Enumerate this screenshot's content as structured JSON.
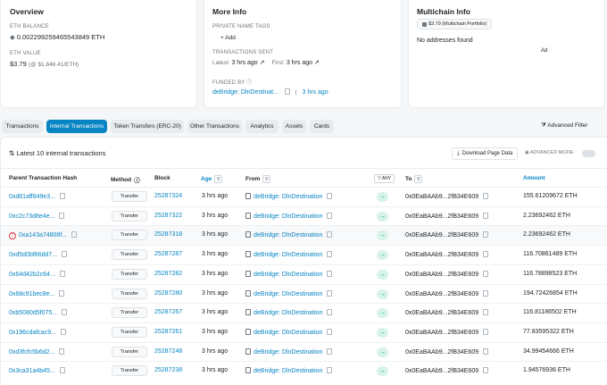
{
  "overview": {
    "title": "Overview",
    "eth_balance_label": "ETH BALANCE",
    "eth_balance": "0.002299259465543849 ETH",
    "eth_value_label": "ETH VALUE",
    "eth_value": "$3.79",
    "eth_value_rate": "(@ $1,646.41/ETH)"
  },
  "more_info": {
    "title": "More Info",
    "tags_label": "PRIVATE NAME TAGS",
    "add_label": "+ Add",
    "tx_sent_label": "TRANSACTIONS SENT",
    "latest_prefix": "Latest:",
    "latest_value": "3 hrs ago",
    "first_prefix": "First:",
    "first_value": "3 hrs ago",
    "funded_label": "FUNDED BY",
    "funded_by": "deBridge: DlnDestinat...",
    "funded_time": "3 hrs ago"
  },
  "multichain": {
    "title": "Multichain Info",
    "badge": "$3.79 (Multichain Portfolio)",
    "no_addresses": "No addresses found",
    "ad": "Ad"
  },
  "tabs": [
    {
      "label": "Transactions"
    },
    {
      "label": "Internal Transactions"
    },
    {
      "label": "Token Transfers (ERC-20)"
    },
    {
      "label": "Other Transactions"
    },
    {
      "label": "Analytics"
    },
    {
      "label": "Assets"
    },
    {
      "label": "Cards"
    }
  ],
  "advanced_filter": "Advanced Filter",
  "table": {
    "summary": "Latest 10 internal transactions",
    "download": "Download Page Data",
    "advanced_mode": "ADVANCED MODE:",
    "headers": {
      "hash": "Parent Transaction Hash",
      "method": "Method",
      "block": "Block",
      "age": "Age",
      "from": "From",
      "any": "ANY",
      "to": "To",
      "amount": "Amount"
    },
    "rows": [
      {
        "hash": "0xd81aff849e3...",
        "method": "Transfer",
        "block": "25287324",
        "age": "3 hrs ago",
        "from": "deBridge: DlnDestination",
        "to": "0x0EaBAAb9...2fB34E609",
        "amount": "155.61209672 ETH"
      },
      {
        "hash": "0xc2c73d8e4e...",
        "method": "Transfer",
        "block": "25287322",
        "age": "3 hrs ago",
        "from": "deBridge: DlnDestination",
        "to": "0x0EaBAAb9...2fB34E609",
        "amount": "2.23692462 ETH"
      },
      {
        "hash": "0xa143a74808f...",
        "method": "Transfer",
        "block": "25287318",
        "age": "3 hrs ago",
        "from": "deBridge: DlnDestination",
        "to": "0x0EaBAAb9...2fB34E609",
        "amount": "2.23692462 ETH"
      },
      {
        "hash": "0xd5d0bf86dd7...",
        "method": "Transfer",
        "block": "25287287",
        "age": "3 hrs ago",
        "from": "deBridge: DlnDestination",
        "to": "0x0EaBAAb9...2fB34E609",
        "amount": "116.70861489 ETH"
      },
      {
        "hash": "0x64d42b2c64...",
        "method": "Transfer",
        "block": "25287282",
        "age": "3 hrs ago",
        "from": "deBridge: DlnDestination",
        "to": "0x0EaBAAb9...2fB34E609",
        "amount": "116.78898523 ETH"
      },
      {
        "hash": "0x68c91bec8e...",
        "method": "Transfer",
        "block": "25287280",
        "age": "3 hrs ago",
        "from": "deBridge: DlnDestination",
        "to": "0x0EaBAAb9...2fB34E609",
        "amount": "194.72426854 ETH"
      },
      {
        "hash": "0xb5080d5f075...",
        "method": "Transfer",
        "block": "25287267",
        "age": "3 hrs ago",
        "from": "deBridge: DlnDestination",
        "to": "0x0EaBAAb9...2fB34E609",
        "amount": "116.81186502 ETH"
      },
      {
        "hash": "0x196cdafcac9...",
        "method": "Transfer",
        "block": "25287261",
        "age": "3 hrs ago",
        "from": "deBridge: DlnDestination",
        "to": "0x0EaBAAb9...2fB34E609",
        "amount": "77.83595322 ETH"
      },
      {
        "hash": "0xd3fcfc5b6d2...",
        "method": "Transfer",
        "block": "25287248",
        "age": "3 hrs ago",
        "from": "deBridge: DlnDestination",
        "to": "0x0EaBAAb9...2fB34E609",
        "amount": "34.99454666 ETH"
      },
      {
        "hash": "0x3ca31a4b45...",
        "method": "Transfer",
        "block": "25287238",
        "age": "3 hrs ago",
        "from": "deBridge: DlnDestination",
        "to": "0x0EaBAAb9...2fB34E609",
        "amount": "1.94576936 ETH"
      }
    ]
  }
}
